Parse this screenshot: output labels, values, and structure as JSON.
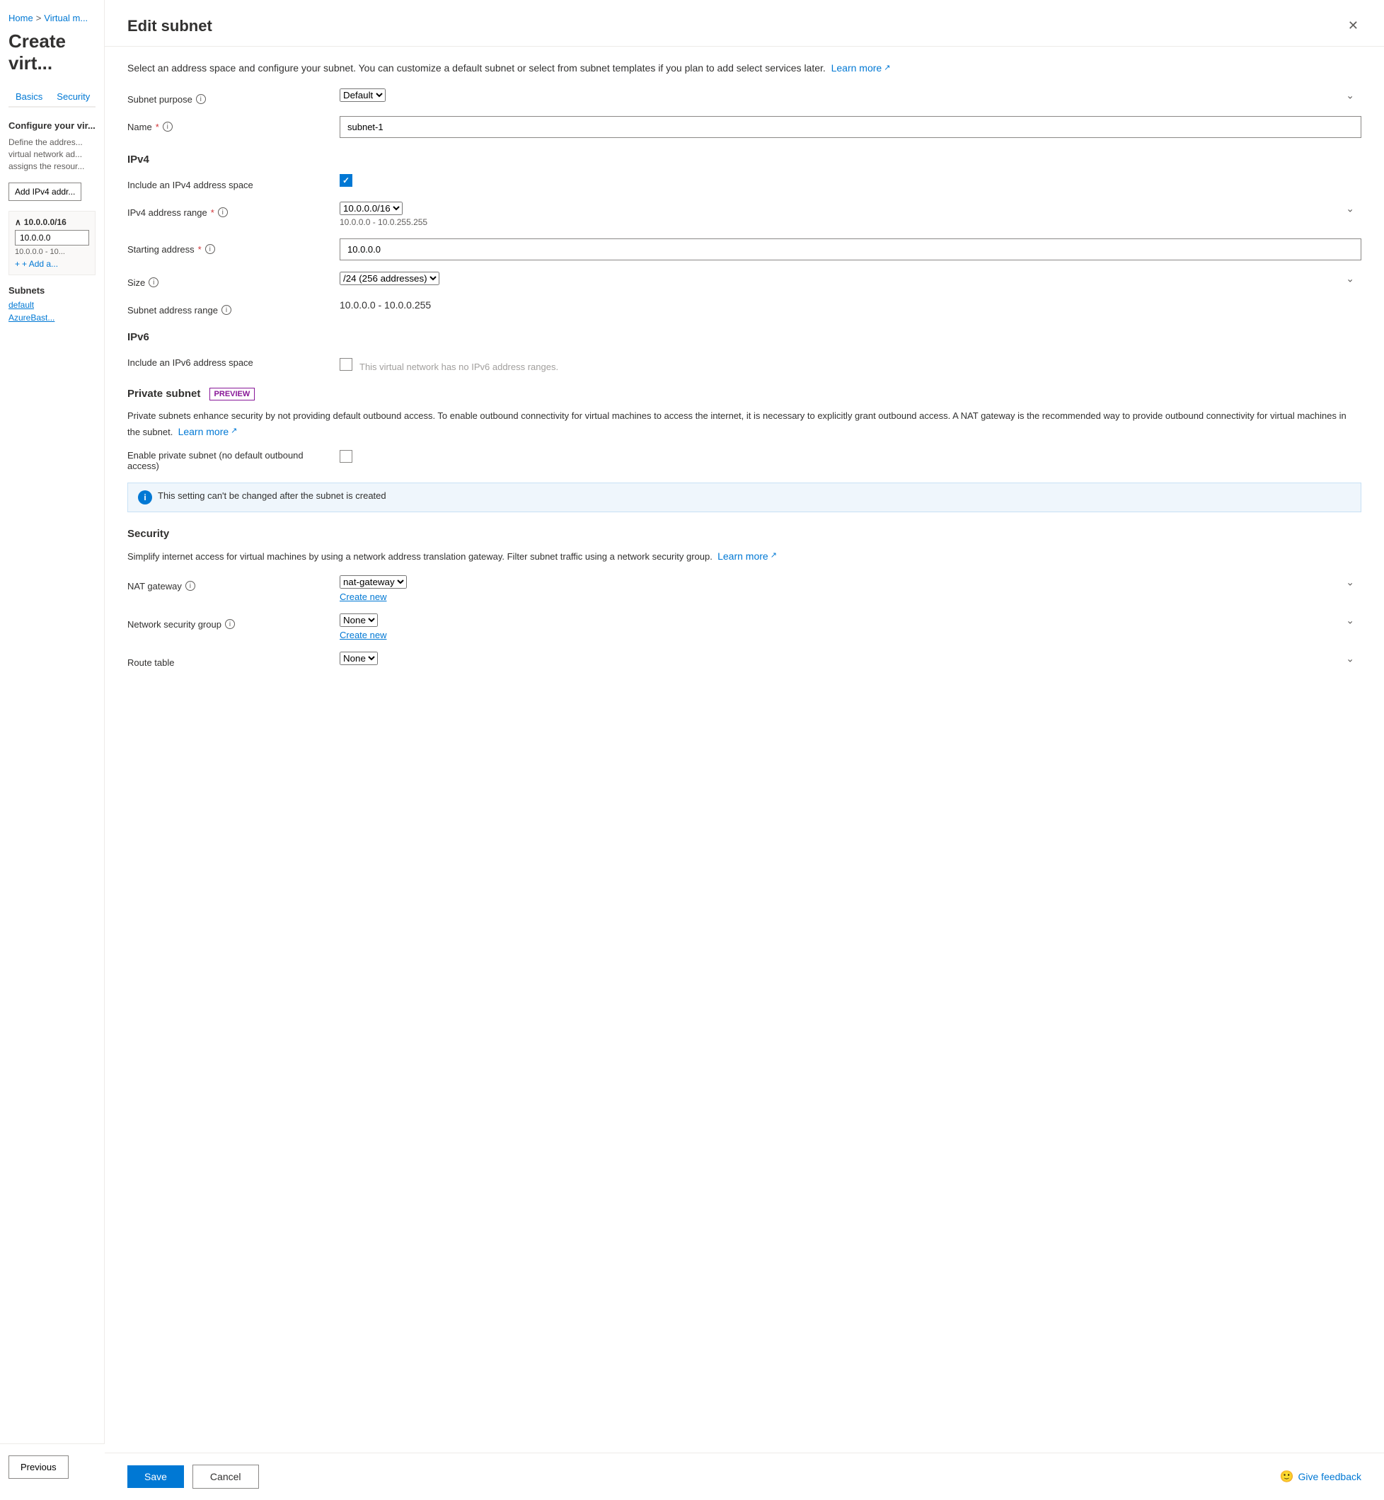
{
  "breadcrumb": {
    "home": "Home",
    "separator": ">",
    "current": "Virtual m..."
  },
  "page_title": "Create virt...",
  "tabs": [
    {
      "label": "Basics",
      "active": false
    },
    {
      "label": "Security",
      "active": false
    }
  ],
  "left_panel": {
    "configure_title": "Configure your vir...",
    "define_desc": "Define the addres... virtual network ad... assigns the resour...",
    "add_btn": "Add IPv4 addr...",
    "address_block": {
      "cidr": "10.0.0.0/16",
      "input_value": "10.0.0.0",
      "range": "10.0.0.0 - 10...",
      "add_link": "+ Add a..."
    },
    "subnets_title": "Subnets",
    "subnet_links": [
      "default",
      "AzureBast..."
    ]
  },
  "drawer": {
    "title": "Edit subnet",
    "intro": "Select an address space and configure your subnet. You can customize a default subnet or select from subnet templates if you plan to add select services later.",
    "learn_more": "Learn more",
    "fields": {
      "subnet_purpose": {
        "label": "Subnet purpose",
        "value": "Default"
      },
      "name": {
        "label": "Name",
        "required": true,
        "value": "subnet-1"
      }
    },
    "ipv4": {
      "heading": "IPv4",
      "include_label": "Include an IPv4 address space",
      "include_checked": true,
      "range_label": "IPv4 address range",
      "range_value": "10.0.0.0/16",
      "range_sub": "10.0.0.0 - 10.0.255.255",
      "starting_label": "Starting address",
      "starting_value": "10.0.0.0",
      "size_label": "Size",
      "size_value": "/24 (256 addresses)",
      "subnet_range_label": "Subnet address range",
      "subnet_range_value": "10.0.0.0 - 10.0.0.255"
    },
    "ipv6": {
      "heading": "IPv6",
      "include_label": "Include an IPv6 address space",
      "disabled_text": "This virtual network has no IPv6 address ranges."
    },
    "private_subnet": {
      "heading": "Private subnet",
      "preview_badge": "PREVIEW",
      "desc": "Private subnets enhance security by not providing default outbound access. To enable outbound connectivity for virtual machines to access the internet, it is necessary to explicitly grant outbound access. A NAT gateway is the recommended way to provide outbound connectivity for virtual machines in the subnet.",
      "learn_more": "Learn more",
      "enable_label": "Enable private subnet (no default outbound access)",
      "info_notice": "This setting can't be changed after the subnet is created"
    },
    "security": {
      "heading": "Security",
      "desc": "Simplify internet access for virtual machines by using a network address translation gateway. Filter subnet traffic using a network security group.",
      "learn_more": "Learn more",
      "nat_gateway_label": "NAT gateway",
      "nat_gateway_value": "nat-gateway",
      "nat_create_new": "Create new",
      "nsg_label": "Network security group",
      "nsg_value": "None",
      "nsg_create_new": "Create new",
      "route_table_label": "Route table",
      "route_table_value": "None"
    },
    "footer": {
      "save": "Save",
      "cancel": "Cancel",
      "feedback": "Give feedback"
    }
  },
  "bottom": {
    "previous": "Previous"
  }
}
